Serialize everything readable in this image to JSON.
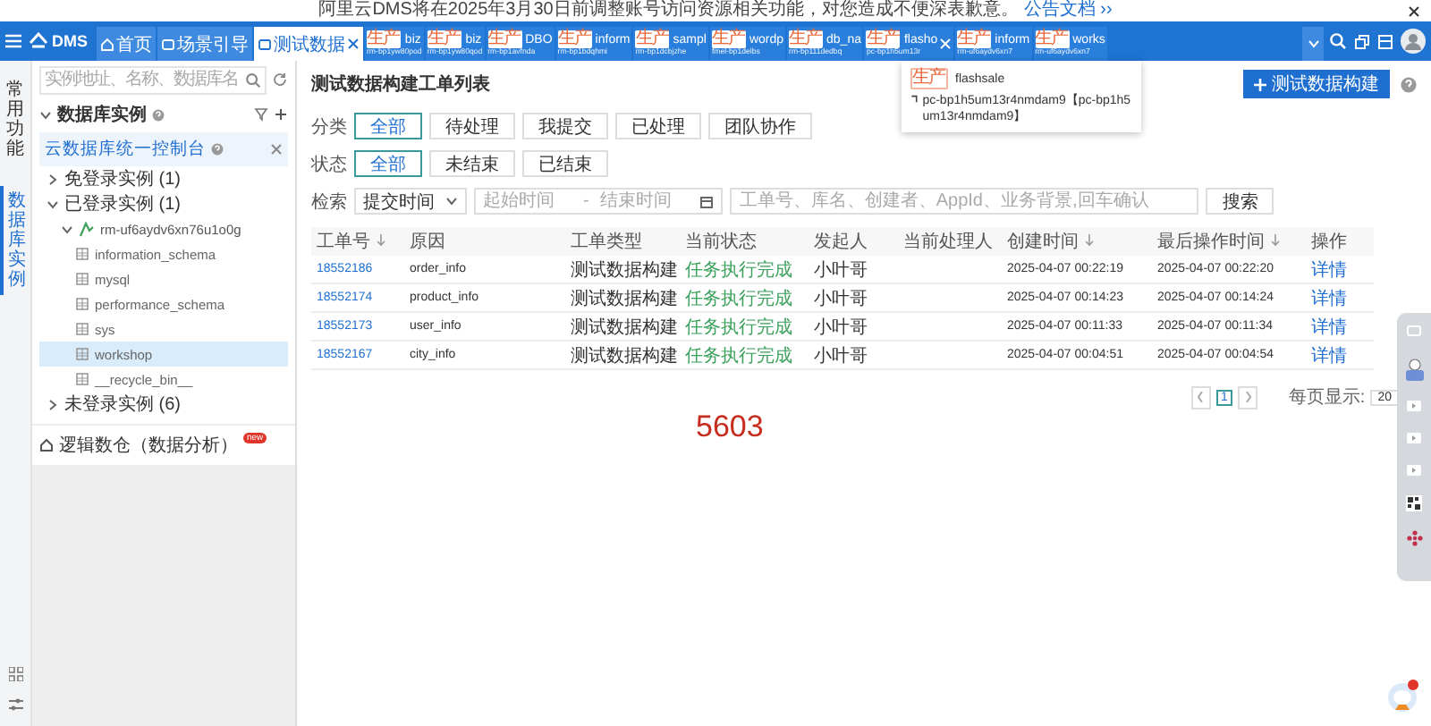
{
  "notice": {
    "text": "阿里云DMS将在2025年3月30日前调整账号访问资源相关功能，对您造成不便深表歉意。",
    "link": "公告文档 ››"
  },
  "header": {
    "brand": "DMS",
    "tabs": [
      {
        "kind": "home",
        "label": "首页",
        "selected": false,
        "closable": false
      },
      {
        "kind": "page",
        "label": "场景引导",
        "selected": false,
        "closable": false
      },
      {
        "kind": "page",
        "label": "测试数据",
        "selected": true,
        "closable": true
      },
      {
        "kind": "instance",
        "env": "生产",
        "label": "biz",
        "sub": "rm-bp1yw80pod",
        "selected": false,
        "closable": false
      },
      {
        "kind": "instance",
        "env": "生产",
        "label": "biz",
        "sub": "rm-bp1yw80qod",
        "selected": false,
        "closable": false
      },
      {
        "kind": "instance",
        "env": "生产",
        "label": "DBO",
        "sub": "rm-bp1avfnda",
        "selected": false,
        "closable": false
      },
      {
        "kind": "instance",
        "env": "生产",
        "label": "inform",
        "sub": "rm-bp1bdqhmi",
        "selected": false,
        "closable": false
      },
      {
        "kind": "instance",
        "env": "生产",
        "label": "sampl",
        "sub": "rm-bp1dcbjzhe",
        "selected": false,
        "closable": false
      },
      {
        "kind": "instance",
        "env": "生产",
        "label": "wordp",
        "sub": "fmel-bp1delbs",
        "selected": false,
        "closable": false
      },
      {
        "kind": "instance",
        "env": "生产",
        "label": "db_na",
        "sub": "rm-bp111dedbq",
        "selected": false,
        "closable": false
      },
      {
        "kind": "instance",
        "env": "生产",
        "label": "flasho",
        "sub": "pc-bp1h5um13r",
        "selected": false,
        "closable": true
      },
      {
        "kind": "instance",
        "env": "生产",
        "label": "inform",
        "sub": "rm-uf6aydv6xn7",
        "selected": false,
        "closable": false
      },
      {
        "kind": "instance",
        "env": "生产",
        "label": "works",
        "sub": "rm-uf6aydv6xn7",
        "selected": false,
        "closable": false
      }
    ],
    "tooltip": {
      "env": "生产",
      "name": "flashsale",
      "detail": "pc-bp1h5um13r4nmdam9【pc-bp1h5um13r4nmdam9】"
    }
  },
  "rail": {
    "items": [
      {
        "label": "常用功能",
        "selected": false
      },
      {
        "label": "数据库实例",
        "selected": true
      }
    ]
  },
  "sidebar": {
    "search_placeholder": "实例地址、名称、数据库名",
    "section": {
      "title": "数据库实例",
      "expanded": true
    },
    "console_link": "云数据库统一控制台",
    "tree": [
      {
        "kind": "group",
        "label": "免登录实例 (1)",
        "expanded": false
      },
      {
        "kind": "group",
        "label": "已登录实例 (1)",
        "expanded": true,
        "children": [
          {
            "kind": "instance",
            "label": "rm-uf6aydv6xn76u1o0g",
            "expanded": true,
            "children": [
              {
                "kind": "database",
                "label": "information_schema",
                "selected": false
              },
              {
                "kind": "database",
                "label": "mysql",
                "selected": false
              },
              {
                "kind": "database",
                "label": "performance_schema",
                "selected": false
              },
              {
                "kind": "database",
                "label": "sys",
                "selected": false
              },
              {
                "kind": "database",
                "label": "workshop",
                "selected": true
              },
              {
                "kind": "database",
                "label": "__recycle_bin__",
                "selected": false
              }
            ]
          }
        ]
      },
      {
        "kind": "group",
        "label": "未登录实例 (6)",
        "expanded": false
      }
    ],
    "footer": {
      "label": "逻辑数仓（数据分析）",
      "badge": "new"
    }
  },
  "main": {
    "title": "测试数据构建工单列表",
    "create_button": "测试数据构建",
    "filters": [
      {
        "label": "分类",
        "options": [
          {
            "label": "全部",
            "selected": true
          },
          {
            "label": "待处理",
            "selected": false
          },
          {
            "label": "我提交",
            "selected": false
          },
          {
            "label": "已处理",
            "selected": false
          },
          {
            "label": "团队协作",
            "selected": false
          }
        ]
      },
      {
        "label": "状态",
        "options": [
          {
            "label": "全部",
            "selected": true
          },
          {
            "label": "未结束",
            "selected": false
          },
          {
            "label": "已结束",
            "selected": false
          }
        ]
      }
    ],
    "search": {
      "label": "检索",
      "time_field": "提交时间",
      "start_placeholder": "起始时间",
      "range_separator": "-",
      "end_placeholder": "结束时间",
      "placeholder": "工单号、库名、创建者、AppId、业务背景,回车确认",
      "button": "搜索"
    },
    "table": {
      "columns": [
        {
          "label": "工单号",
          "sortable": true
        },
        {
          "label": "原因",
          "sortable": false
        },
        {
          "label": "工单类型",
          "sortable": false
        },
        {
          "label": "当前状态",
          "sortable": false
        },
        {
          "label": "发起人",
          "sortable": false
        },
        {
          "label": "当前处理人",
          "sortable": false
        },
        {
          "label": "创建时间",
          "sortable": true
        },
        {
          "label": "最后操作时间",
          "sortable": true
        },
        {
          "label": "操作",
          "sortable": false
        }
      ],
      "rows": [
        {
          "id": "18552186",
          "reason": "order_info",
          "type": "测试数据构建",
          "status": "任务执行完成",
          "initiator": "小叶哥",
          "created": "2025-04-07 00:22:19",
          "updated": "2025-04-07 00:22:20",
          "action": "详情"
        },
        {
          "id": "18552174",
          "reason": "product_info",
          "type": "测试数据构建",
          "status": "任务执行完成",
          "initiator": "小叶哥",
          "created": "2025-04-07 00:14:23",
          "updated": "2025-04-07 00:14:24",
          "action": "详情"
        },
        {
          "id": "18552173",
          "reason": "user_info",
          "type": "测试数据构建",
          "status": "任务执行完成",
          "initiator": "小叶哥",
          "created": "2025-04-07 00:11:33",
          "updated": "2025-04-07 00:11:34",
          "action": "详情"
        },
        {
          "id": "18552167",
          "reason": "city_info",
          "type": "测试数据构建",
          "status": "任务执行完成",
          "initiator": "小叶哥",
          "created": "2025-04-07 00:04:51",
          "updated": "2025-04-07 00:04:54",
          "action": "详情"
        }
      ]
    },
    "pagination": {
      "page": "1",
      "page_size_label": "每页显示:",
      "page_size": "20"
    },
    "overlay_number": "5603"
  }
}
